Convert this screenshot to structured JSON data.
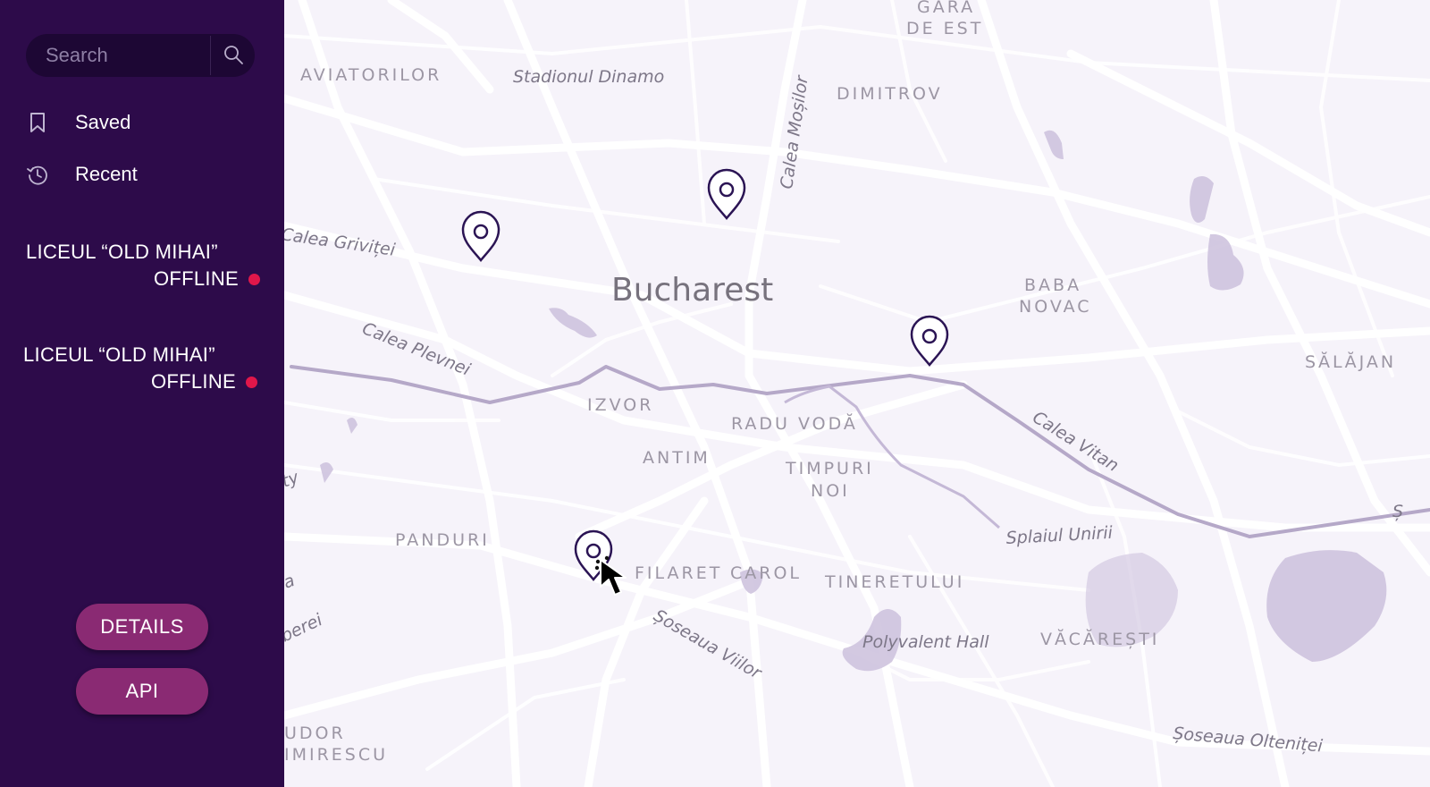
{
  "colors": {
    "sidebar_bg": "#2d0b4a",
    "search_bg": "#1d0734",
    "accent_button": "#8a2a73",
    "offline_dot": "#e0174a",
    "pin_stroke": "#2b1454",
    "map_bg": "#f6f3fa"
  },
  "search": {
    "placeholder": "Search",
    "icon": "search-icon"
  },
  "nav": [
    {
      "label": "Saved",
      "icon": "bookmark-icon"
    },
    {
      "label": "Recent",
      "icon": "history-icon"
    }
  ],
  "schools": [
    {
      "name": "LICEUL “OLD MIHAI”",
      "status": "OFFLINE"
    },
    {
      "name": "LICEUL “OLD MIHAI”",
      "status": "OFFLINE"
    }
  ],
  "buttons": {
    "details": "DETAILS",
    "api": "API"
  },
  "map": {
    "city": "Bucharest",
    "areas": {
      "gara_line1": "GARA",
      "gara_line2": "DE EST",
      "aviatorilor": "AVIATORILOR",
      "dimitrov": "DIMITROV",
      "baba_line1": "BABA",
      "baba_line2": "NOVAC",
      "salajan": "SĂLĂJAN",
      "izvor": "IZVOR",
      "radu_voda": "RADU VODĂ",
      "antim": "ANTIM",
      "timpuri_line1": "TIMPURI",
      "timpuri_line2": "NOI",
      "panduri": "PANDURI",
      "filaret": "FILARET",
      "carol": "CAROL",
      "tineretului": "TINERETULUI",
      "vacaresti": "VĂCĂREȘTI",
      "udor": "UDOR",
      "imirescu": "IMIRESCU"
    },
    "streets": {
      "stadion": "Stadionul Dinamo",
      "mosilor": "Calea Moșilor",
      "grivitei": "Calea Griviței",
      "plevnei": "Calea Plevnei",
      "vitan": "Calea Vitan",
      "splaiul": "Splaiul Unirii",
      "viilor": "Șoseaua Viilor",
      "oltenitei": "Șoseaua Olteniței",
      "polyvalent": "Polyvalent Hall",
      "ty": "ty",
      "a": "a",
      "berei": "berei",
      "s": "Ș"
    },
    "pins": [
      "map-pin-icon",
      "map-pin-icon",
      "map-pin-icon",
      "map-pin-icon"
    ]
  }
}
